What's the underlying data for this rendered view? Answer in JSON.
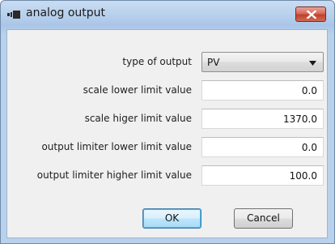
{
  "window": {
    "title": "analog output",
    "close_icon": "close-x-icon",
    "app_icon": "analog-output-icon"
  },
  "form": {
    "type_of_output": {
      "label": "type of output",
      "value": "PV"
    },
    "scale_lower": {
      "label": "scale lower limit value",
      "value": "0.0"
    },
    "scale_higher": {
      "label": "scale higer limit value",
      "value": "1370.0"
    },
    "limiter_lower": {
      "label": "output limiter lower limit value",
      "value": "0.0"
    },
    "limiter_higher": {
      "label": "output limiter higher limit value",
      "value": "100.0"
    }
  },
  "buttons": {
    "ok_label": "OK",
    "cancel_label": "Cancel"
  },
  "colors": {
    "titlebar": "#b8d0ec",
    "client_bg": "#f0f0f0",
    "close_button": "#c2402d",
    "ok_button_focus": "#48b4e8"
  }
}
